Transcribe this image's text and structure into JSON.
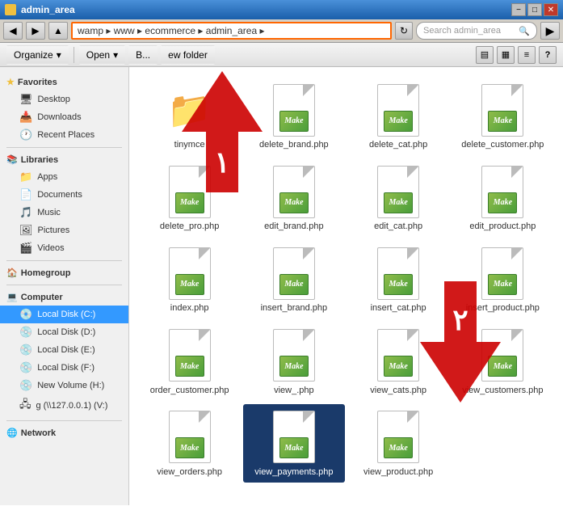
{
  "titleBar": {
    "title": "admin_area",
    "icon": "folder",
    "buttons": [
      "−",
      "□",
      "✕"
    ]
  },
  "addressBar": {
    "path": "wamp ▸ www ▸ ecommerce ▸ admin_area ▸",
    "searchPlaceholder": "Search admin_area",
    "navBack": "◀",
    "navForward": "▶",
    "refresh": "↻"
  },
  "toolbar": {
    "organize": "Organize",
    "open": "Open",
    "burn": "B...",
    "newFolder": "ew folder"
  },
  "sidebar": {
    "favorites": {
      "header": "Favorites",
      "items": [
        {
          "label": "Desktop",
          "icon": "🖥"
        },
        {
          "label": "Downloads",
          "icon": "📥"
        },
        {
          "label": "Recent Places",
          "icon": "🕐"
        }
      ]
    },
    "libraries": {
      "header": "Libraries",
      "items": [
        {
          "label": "Apps",
          "icon": "📁"
        },
        {
          "label": "Documents",
          "icon": "📄"
        },
        {
          "label": "Music",
          "icon": "🎵"
        },
        {
          "label": "Pictures",
          "icon": "🖼"
        },
        {
          "label": "Videos",
          "icon": "🎬"
        }
      ]
    },
    "homegroup": {
      "header": "Homegroup",
      "items": []
    },
    "computer": {
      "header": "Computer",
      "items": [
        {
          "label": "Local Disk (C:)",
          "icon": "💿"
        },
        {
          "label": "Local Disk (D:)",
          "icon": "💿"
        },
        {
          "label": "Local Disk (E:)",
          "icon": "💿"
        },
        {
          "label": "Local Disk (F:)",
          "icon": "💿"
        },
        {
          "label": "New Volume (H:)",
          "icon": "💿"
        },
        {
          "label": "g (\\\\127.0.0.1) (V:)",
          "icon": "🖧"
        }
      ]
    },
    "network": {
      "header": "Network",
      "items": []
    }
  },
  "files": [
    {
      "name": "tinymce",
      "type": "folder"
    },
    {
      "name": "delete_brand.php",
      "type": "php"
    },
    {
      "name": "delete_cat.php",
      "type": "php"
    },
    {
      "name": "delete_customer.php",
      "type": "php"
    },
    {
      "name": "delete_pro.php",
      "type": "php"
    },
    {
      "name": "edit_brand.php",
      "type": "php"
    },
    {
      "name": "edit_cat.php",
      "type": "php"
    },
    {
      "name": "edit_product.php",
      "type": "php"
    },
    {
      "name": "index.php",
      "type": "php"
    },
    {
      "name": "insert_brand.php",
      "type": "php"
    },
    {
      "name": "insert_cat.php",
      "type": "php"
    },
    {
      "name": "insert_product.php",
      "type": "php"
    },
    {
      "name": "order_customer.php",
      "type": "php"
    },
    {
      "name": "view_.php",
      "type": "php"
    },
    {
      "name": "view_cats.php",
      "type": "php"
    },
    {
      "name": "view_customers.php",
      "type": "php"
    },
    {
      "name": "view_orders.php",
      "type": "php"
    },
    {
      "name": "view_payments.php",
      "type": "php",
      "selected": true
    },
    {
      "name": "view_product.php",
      "type": "php"
    }
  ],
  "arrows": {
    "upLabel": "۱",
    "downLabel": "۲"
  },
  "colors": {
    "accent": "#ff6600",
    "selected": "#1a3a6a",
    "arrowRed": "#cc0000",
    "titlebarTop": "#4a90d9",
    "titlebarBottom": "#1a5faa"
  }
}
